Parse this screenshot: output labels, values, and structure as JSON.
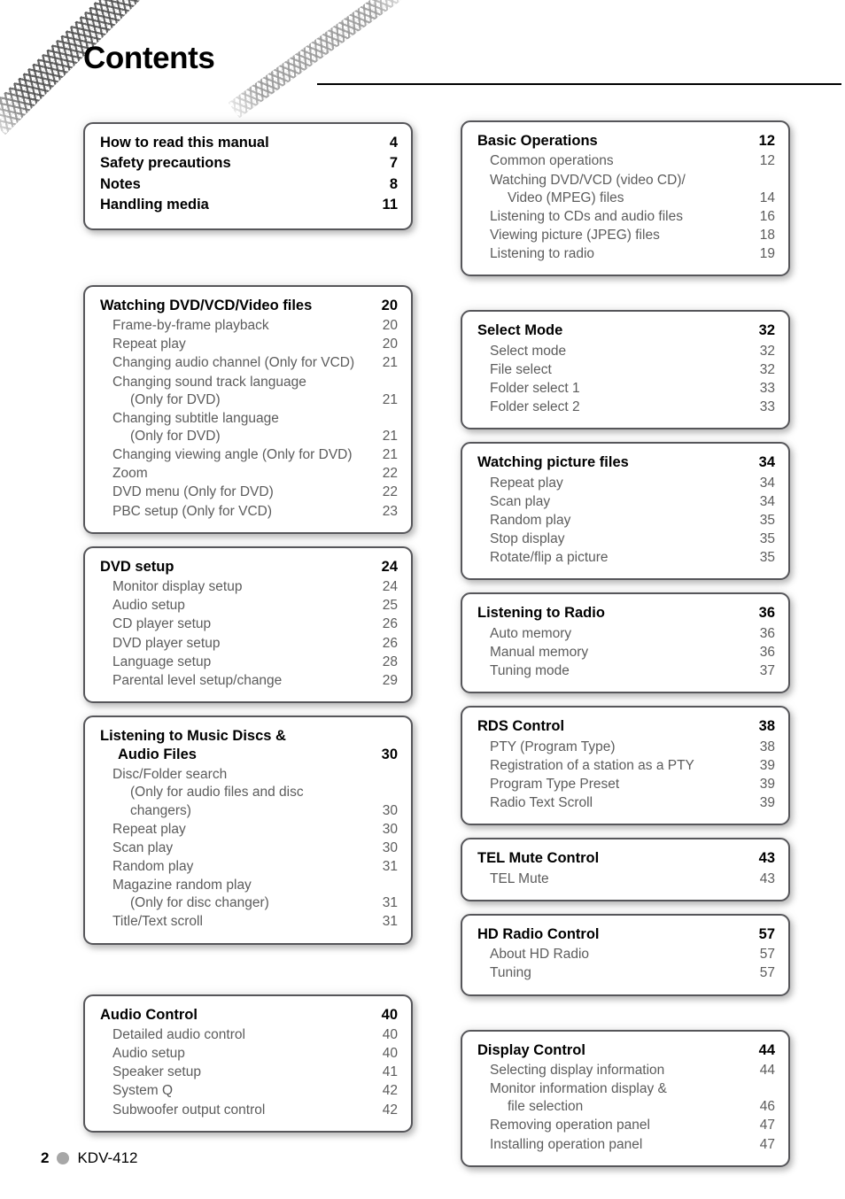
{
  "page": {
    "title": "Contents",
    "footer": {
      "page_number": "2",
      "model": "KDV-412",
      "dot_color": "#a7a7a7"
    },
    "colors": {
      "box_border": "#56565a",
      "sub_text": "#5c5c5c",
      "main_text": "#000000"
    }
  },
  "columns": {
    "left": [
      {
        "boxes": [
          {
            "name": "how-to-read-box",
            "rows": [
              {
                "type": "main",
                "title": "How to read this manual",
                "page": "4"
              },
              {
                "type": "main",
                "title": "Safety precautions",
                "page": "7"
              },
              {
                "type": "main",
                "title": "Notes",
                "page": "8"
              },
              {
                "type": "main",
                "title": "Handling media",
                "page": "11"
              }
            ]
          }
        ]
      },
      {
        "boxes": [
          {
            "name": "watching-dvd-vcd-video-files-box",
            "rows": [
              {
                "type": "main",
                "title": "Watching DVD/VCD/Video files",
                "page": "20"
              },
              {
                "type": "sub",
                "title": "Frame-by-frame playback",
                "page": "20"
              },
              {
                "type": "sub",
                "title": "Repeat play",
                "page": "20"
              },
              {
                "type": "sub",
                "title": "Changing audio channel (Only for VCD)",
                "page": "21"
              },
              {
                "type": "sub",
                "title": "Changing sound track language",
                "title2": "(Only for DVD)",
                "page": "21"
              },
              {
                "type": "sub",
                "title": "Changing subtitle language",
                "title2": "(Only for DVD)",
                "page": "21"
              },
              {
                "type": "sub",
                "title": "Changing viewing angle (Only for DVD)",
                "page": "21"
              },
              {
                "type": "sub",
                "title": "Zoom",
                "page": "22"
              },
              {
                "type": "sub",
                "title": "DVD menu (Only for DVD)",
                "page": "22"
              },
              {
                "type": "sub",
                "title": "PBC setup (Only for VCD)",
                "page": "23"
              }
            ]
          },
          {
            "name": "dvd-setup-box",
            "rows": [
              {
                "type": "main",
                "title": "DVD setup",
                "page": "24"
              },
              {
                "type": "sub",
                "title": "Monitor display setup",
                "page": "24"
              },
              {
                "type": "sub",
                "title": "Audio setup",
                "page": "25"
              },
              {
                "type": "sub",
                "title": "CD player setup",
                "page": "26"
              },
              {
                "type": "sub",
                "title": "DVD player setup",
                "page": "26"
              },
              {
                "type": "sub",
                "title": "Language setup",
                "page": "28"
              },
              {
                "type": "sub",
                "title": "Parental level setup/change",
                "page": "29"
              }
            ]
          },
          {
            "name": "listening-to-music-discs-box",
            "rows": [
              {
                "type": "main",
                "title": "Listening to Music Discs &",
                "title2": "Audio Files",
                "page": "30"
              },
              {
                "type": "sub",
                "title": "Disc/Folder search",
                "title2": "(Only for audio files and disc changers)",
                "page": "30"
              },
              {
                "type": "sub",
                "title": "Repeat play",
                "page": "30"
              },
              {
                "type": "sub",
                "title": "Scan play",
                "page": "30"
              },
              {
                "type": "sub",
                "title": "Random play",
                "page": "31"
              },
              {
                "type": "sub",
                "title": "Magazine random play",
                "title2": "(Only for disc changer)",
                "page": "31"
              },
              {
                "type": "sub",
                "title": "Title/Text scroll",
                "page": "31"
              }
            ]
          }
        ]
      },
      {
        "boxes": [
          {
            "name": "audio-control-box",
            "rows": [
              {
                "type": "main",
                "title": "Audio Control",
                "page": "40"
              },
              {
                "type": "sub",
                "title": "Detailed audio control",
                "page": "40"
              },
              {
                "type": "sub",
                "title": "Audio setup",
                "page": "40"
              },
              {
                "type": "sub",
                "title": "Speaker setup",
                "page": "41"
              },
              {
                "type": "sub",
                "title": "System Q",
                "page": "42"
              },
              {
                "type": "sub",
                "title": "Subwoofer output control",
                "page": "42"
              }
            ]
          }
        ]
      }
    ],
    "right": [
      {
        "boxes": [
          {
            "name": "basic-operations-box",
            "rows": [
              {
                "type": "main",
                "title": "Basic Operations",
                "page": "12"
              },
              {
                "type": "sub",
                "title": "Common operations",
                "page": "12"
              },
              {
                "type": "sub",
                "title": "Watching DVD/VCD (video CD)/",
                "title2": "Video (MPEG) files",
                "page": "14"
              },
              {
                "type": "sub",
                "title": "Listening to CDs and audio files",
                "page": "16"
              },
              {
                "type": "sub",
                "title": "Viewing picture (JPEG) files",
                "page": "18"
              },
              {
                "type": "sub",
                "title": "Listening to radio",
                "page": "19"
              }
            ]
          }
        ]
      },
      {
        "boxes": [
          {
            "name": "select-mode-box",
            "rows": [
              {
                "type": "main",
                "title": "Select Mode",
                "page": "32"
              },
              {
                "type": "sub",
                "title": "Select mode",
                "page": "32"
              },
              {
                "type": "sub",
                "title": "File select",
                "page": "32"
              },
              {
                "type": "sub",
                "title": "Folder select 1",
                "page": "33"
              },
              {
                "type": "sub",
                "title": "Folder select 2",
                "page": "33"
              }
            ]
          },
          {
            "name": "watching-picture-files-box",
            "rows": [
              {
                "type": "main",
                "title": "Watching picture files",
                "page": "34"
              },
              {
                "type": "sub",
                "title": "Repeat play",
                "page": "34"
              },
              {
                "type": "sub",
                "title": "Scan play",
                "page": "34"
              },
              {
                "type": "sub",
                "title": "Random play",
                "page": "35"
              },
              {
                "type": "sub",
                "title": "Stop display",
                "page": "35"
              },
              {
                "type": "sub",
                "title": "Rotate/flip a picture",
                "page": "35"
              }
            ]
          },
          {
            "name": "listening-to-radio-box",
            "rows": [
              {
                "type": "main",
                "title": "Listening to Radio",
                "page": "36"
              },
              {
                "type": "sub",
                "title": "Auto memory",
                "page": "36"
              },
              {
                "type": "sub",
                "title": "Manual memory",
                "page": "36"
              },
              {
                "type": "sub",
                "title": "Tuning mode",
                "page": "37"
              }
            ]
          },
          {
            "name": "rds-control-box",
            "rows": [
              {
                "type": "main",
                "title": "RDS Control",
                "page": "38"
              },
              {
                "type": "sub",
                "title": "PTY (Program Type)",
                "page": "38"
              },
              {
                "type": "sub",
                "title": "Registration of a station as a PTY",
                "page": "39"
              },
              {
                "type": "sub",
                "title": "Program Type Preset",
                "page": "39"
              },
              {
                "type": "sub",
                "title": "Radio Text Scroll",
                "page": "39"
              }
            ]
          },
          {
            "name": "tel-mute-control-box",
            "rows": [
              {
                "type": "main",
                "title": "TEL Mute Control",
                "page": "43"
              },
              {
                "type": "sub",
                "title": "TEL Mute",
                "page": "43"
              }
            ]
          },
          {
            "name": "hd-radio-control-box",
            "rows": [
              {
                "type": "main",
                "title": "HD Radio Control",
                "page": "57"
              },
              {
                "type": "sub",
                "title": "About HD Radio",
                "page": "57"
              },
              {
                "type": "sub",
                "title": "Tuning",
                "page": "57"
              }
            ]
          }
        ]
      },
      {
        "boxes": [
          {
            "name": "display-control-box",
            "rows": [
              {
                "type": "main",
                "title": "Display Control",
                "page": "44"
              },
              {
                "type": "sub",
                "title": "Selecting display information",
                "page": "44"
              },
              {
                "type": "sub",
                "title": "Monitor information display &",
                "title2": "file selection",
                "page": "46"
              },
              {
                "type": "sub",
                "title": "Removing operation panel",
                "page": "47"
              },
              {
                "type": "sub",
                "title": "Installing operation panel",
                "page": "47"
              }
            ]
          }
        ]
      }
    ]
  }
}
